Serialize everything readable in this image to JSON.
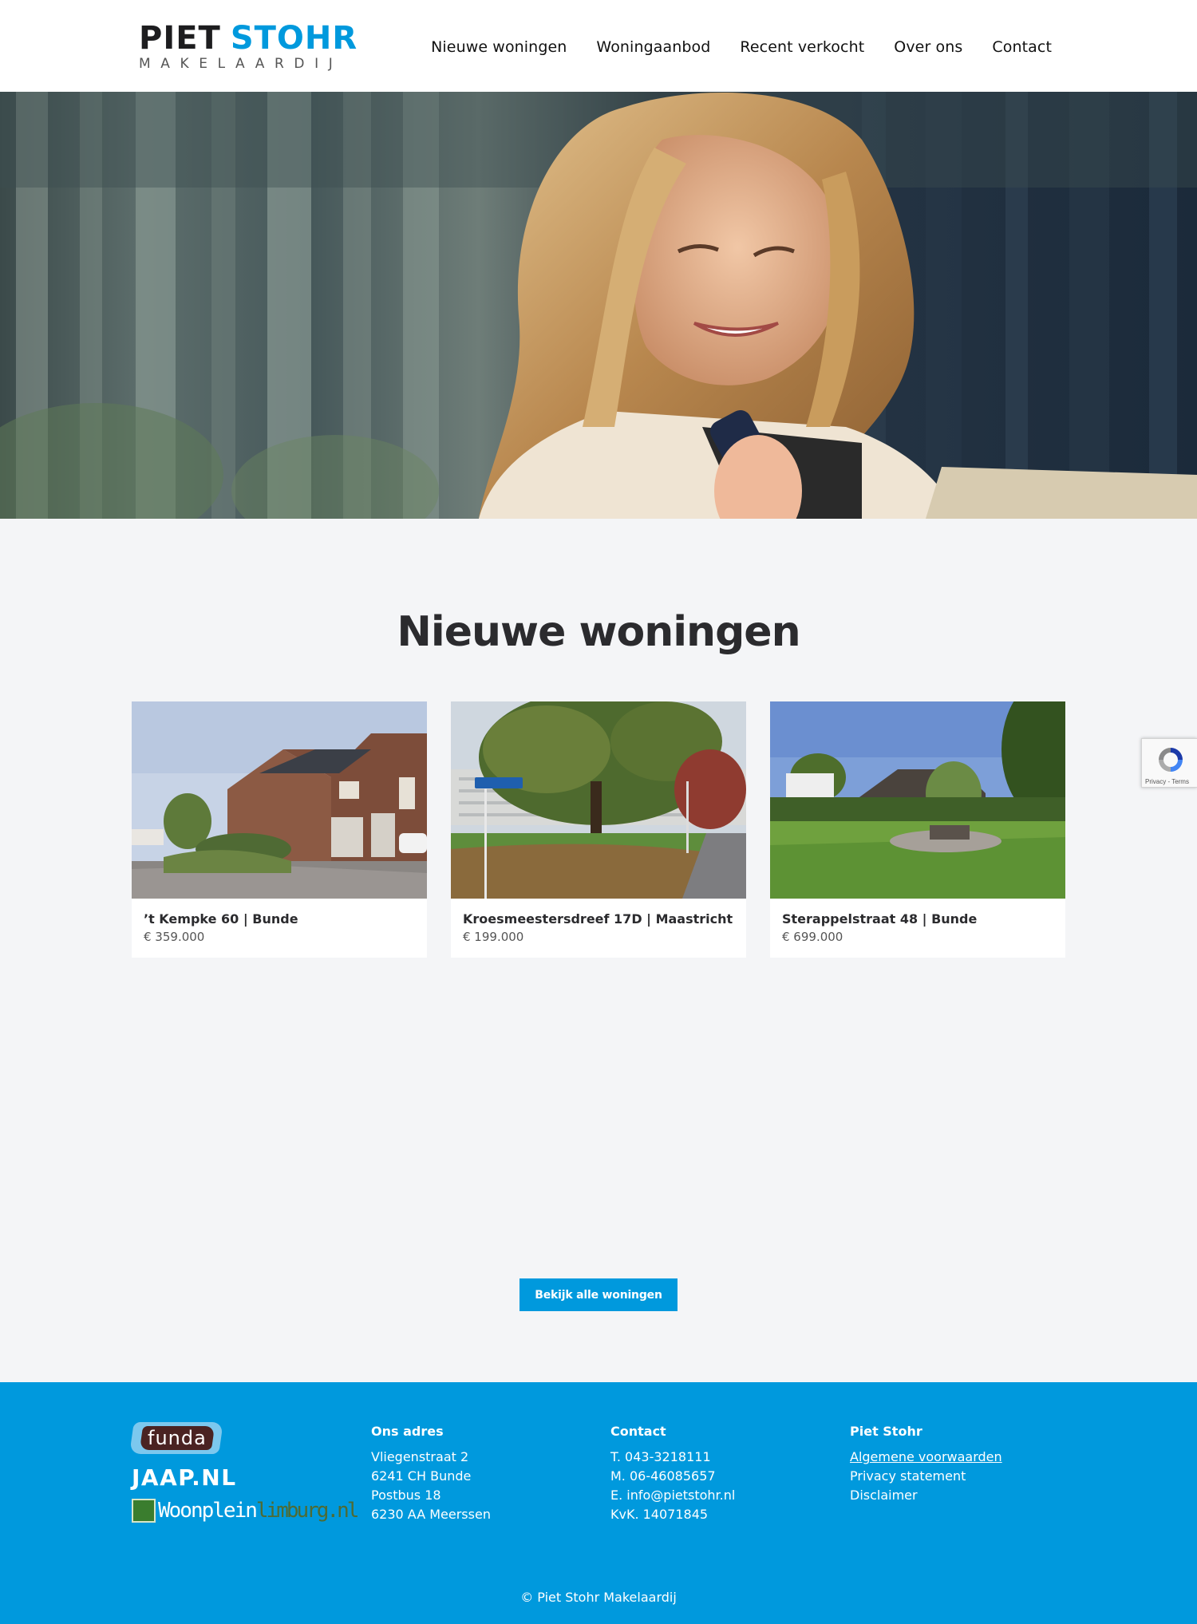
{
  "header": {
    "logo": {
      "word1": "PIET",
      "word2": "STOHR",
      "sub": "MAKELAARDIJ"
    },
    "nav": [
      {
        "label": "Nieuwe woningen"
      },
      {
        "label": "Woningaanbod"
      },
      {
        "label": "Recent verkocht"
      },
      {
        "label": "Over ons"
      },
      {
        "label": "Contact"
      }
    ]
  },
  "main": {
    "title": "Nieuwe woningen",
    "listings": [
      {
        "address": "’t Kempke 60 | Bunde",
        "price": "€ 359.000"
      },
      {
        "address": "Kroesmeestersdreef 17D | Maastricht",
        "price": "€ 199.000"
      },
      {
        "address": "Sterappelstraat 48 | Bunde",
        "price": "€ 699.000"
      }
    ],
    "button_label": "Bekijk alle woningen",
    "recaptcha_text": "Privacy - Terms"
  },
  "footer": {
    "partners": {
      "funda": "funda",
      "jaap": "JAAP.NL",
      "woonplein_a": "Woonplein",
      "woonplein_b": "limburg.nl"
    },
    "address": {
      "heading": "Ons adres",
      "lines": [
        "Vliegenstraat 2",
        "6241 CH Bunde",
        "Postbus 18",
        "6230 AA Meerssen"
      ]
    },
    "contact": {
      "heading": "Contact",
      "lines": [
        "T. 043-3218111",
        "M. 06-46085657",
        "E. info@pietstohr.nl",
        "KvK. 14071845"
      ]
    },
    "company": {
      "heading": "Piet Stohr",
      "links": [
        "Algemene voorwaarden",
        "Privacy statement",
        "Disclaimer"
      ]
    },
    "copyright": "© Piet Stohr Makelaardij"
  },
  "colors": {
    "brand_blue": "#0099dd",
    "dark_text": "#2b2b2e",
    "background": "#f4f5f7"
  }
}
